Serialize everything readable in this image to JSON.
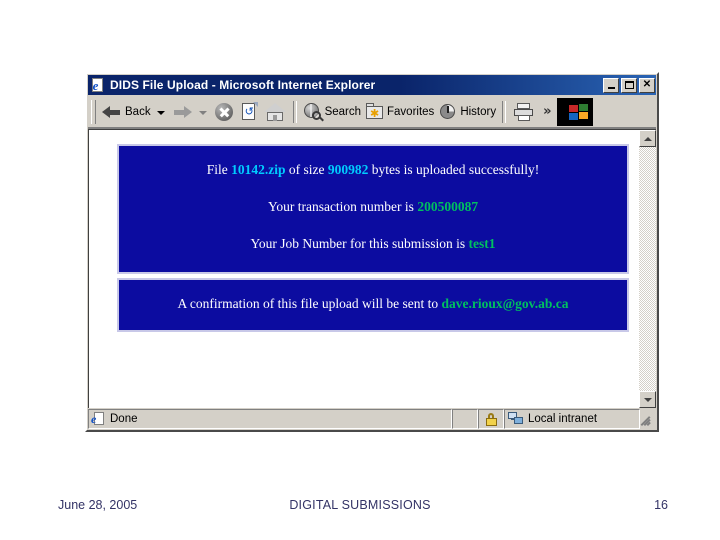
{
  "slide": {
    "footer": {
      "date": "June 28, 2005",
      "center_title": "DIGITAL SUBMISSIONS",
      "page_number": "16"
    }
  },
  "browser": {
    "title": "DIDS File Upload - Microsoft Internet Explorer",
    "window_buttons": {
      "minimize": "_",
      "maximize": "□",
      "close": "✕"
    },
    "toolbar": {
      "back_label": "Back",
      "forward_label": "",
      "search_label": "Search",
      "favorites_label": "Favorites",
      "history_label": "History",
      "overflow_label": "»"
    },
    "statusbar": {
      "message": "Done",
      "zone": "Local intranet"
    }
  },
  "page": {
    "panel_top": {
      "line1": {
        "prefix": "File ",
        "filename": "10142.zip",
        "middle": " of size ",
        "filesize": "900982",
        "suffix": " bytes is uploaded successfully!"
      },
      "line2": {
        "prefix": "Your transaction number is ",
        "transaction_number": "200500087"
      },
      "line3": {
        "prefix": "Your Job Number for this submission is ",
        "job_number": "test1"
      }
    },
    "panel_bottom": {
      "line1": {
        "prefix": "A confirmation of this file upload will be sent to ",
        "email": "dave.rioux@gov.ab.ca"
      }
    },
    "colors": {
      "panel_background": "#0c0ca0",
      "highlight_cyan": "#00ccff",
      "highlight_green": "#00c060",
      "text": "#ffffff"
    }
  }
}
